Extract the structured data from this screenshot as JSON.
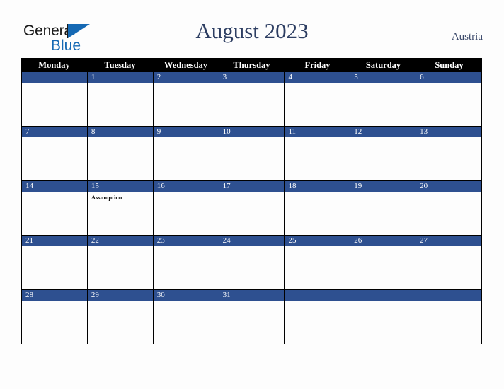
{
  "brand": {
    "name_part1": "General",
    "name_part2": "Blue",
    "triangle_color": "#1569b4",
    "text_color": "#1a1a1a"
  },
  "header": {
    "title": "August 2023",
    "country": "Austria",
    "title_color": "#2d3e62"
  },
  "calendar": {
    "month": "August",
    "year": "2023",
    "accent_color": "#2e5090",
    "header_bg": "#000000",
    "weekdays": [
      "Monday",
      "Tuesday",
      "Wednesday",
      "Thursday",
      "Friday",
      "Saturday",
      "Sunday"
    ],
    "weeks": [
      [
        {
          "date": "",
          "events": []
        },
        {
          "date": "1",
          "events": []
        },
        {
          "date": "2",
          "events": []
        },
        {
          "date": "3",
          "events": []
        },
        {
          "date": "4",
          "events": []
        },
        {
          "date": "5",
          "events": []
        },
        {
          "date": "6",
          "events": []
        }
      ],
      [
        {
          "date": "7",
          "events": []
        },
        {
          "date": "8",
          "events": []
        },
        {
          "date": "9",
          "events": []
        },
        {
          "date": "10",
          "events": []
        },
        {
          "date": "11",
          "events": []
        },
        {
          "date": "12",
          "events": []
        },
        {
          "date": "13",
          "events": []
        }
      ],
      [
        {
          "date": "14",
          "events": []
        },
        {
          "date": "15",
          "events": [
            "Assumption"
          ]
        },
        {
          "date": "16",
          "events": []
        },
        {
          "date": "17",
          "events": []
        },
        {
          "date": "18",
          "events": []
        },
        {
          "date": "19",
          "events": []
        },
        {
          "date": "20",
          "events": []
        }
      ],
      [
        {
          "date": "21",
          "events": []
        },
        {
          "date": "22",
          "events": []
        },
        {
          "date": "23",
          "events": []
        },
        {
          "date": "24",
          "events": []
        },
        {
          "date": "25",
          "events": []
        },
        {
          "date": "26",
          "events": []
        },
        {
          "date": "27",
          "events": []
        }
      ],
      [
        {
          "date": "28",
          "events": []
        },
        {
          "date": "29",
          "events": []
        },
        {
          "date": "30",
          "events": []
        },
        {
          "date": "31",
          "events": []
        },
        {
          "date": "",
          "events": []
        },
        {
          "date": "",
          "events": []
        },
        {
          "date": "",
          "events": []
        }
      ]
    ]
  }
}
